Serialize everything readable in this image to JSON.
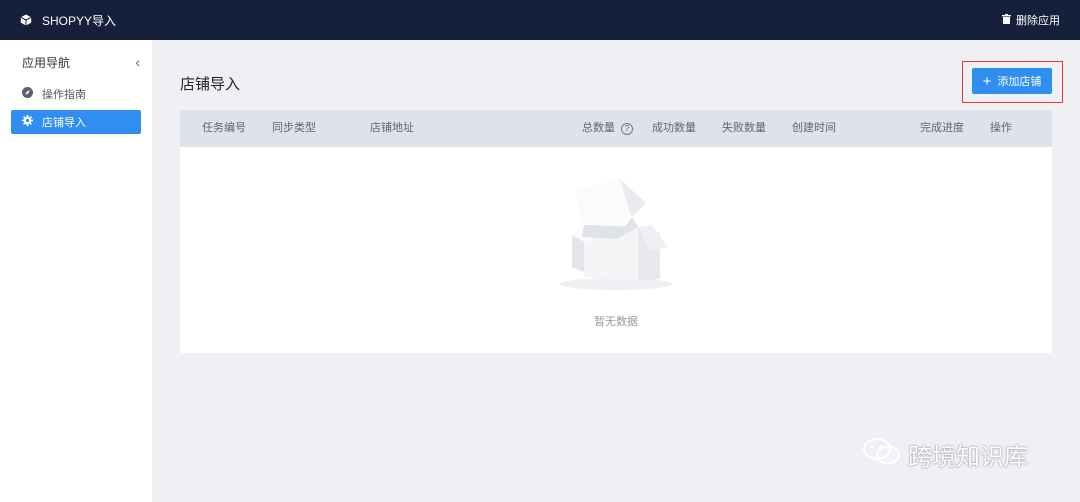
{
  "app": {
    "title": "SHOPYY导入",
    "delete_label": "删除应用"
  },
  "sidebar": {
    "heading": "应用导航",
    "collapse_glyph": "‹",
    "items": [
      {
        "label": "操作指南",
        "icon": "compass-icon",
        "active": false
      },
      {
        "label": "店铺导入",
        "icon": "gear-icon",
        "active": true
      }
    ]
  },
  "main": {
    "title": "店铺导入",
    "add_button": {
      "label": "添加店铺",
      "icon": "plus-icon"
    }
  },
  "table": {
    "columns": [
      "任务编号",
      "同步类型",
      "店铺地址",
      "总数量",
      "成功数量",
      "失败数量",
      "创建时间",
      "完成进度",
      "操作"
    ],
    "help_glyph": "?",
    "rows": [],
    "empty_text": "暂无数据"
  },
  "watermark": {
    "text": "跨境知识库"
  },
  "colors": {
    "topbar": "#17203a",
    "primary": "#2f8ef0",
    "highlight_box": "#e53935",
    "page_bg": "#eef0f4",
    "table_header": "#dde2eb"
  }
}
